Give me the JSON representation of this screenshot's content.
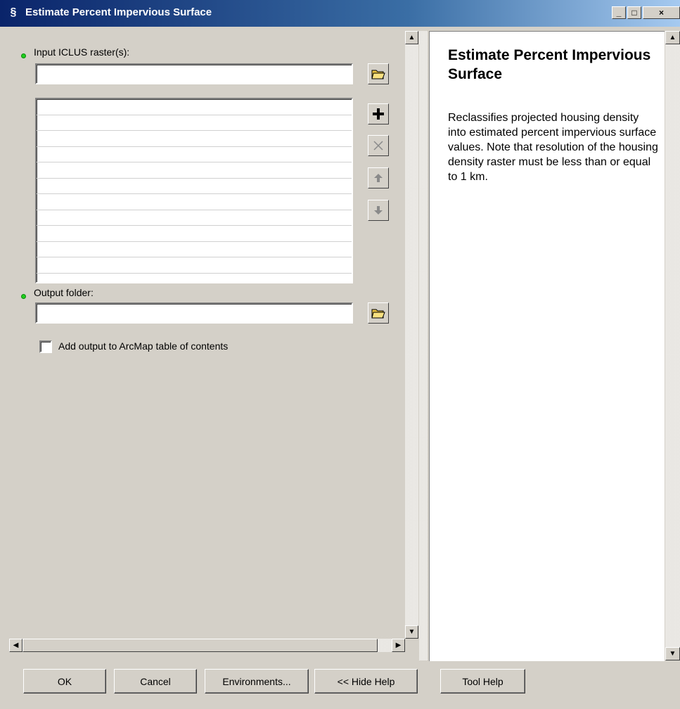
{
  "window": {
    "title": "Estimate Percent Impervious Surface",
    "minimize": "_",
    "maximize": "□",
    "close": "×"
  },
  "form": {
    "input_label": "Input ICLUS raster(s):",
    "input_value": "",
    "list_rows": [
      "",
      "",
      "",
      "",
      "",
      "",
      "",
      "",
      "",
      "",
      ""
    ],
    "output_label": "Output folder:",
    "output_value": "",
    "checkbox_label": "Add output to ArcMap table of contents",
    "checkbox_checked": false
  },
  "help": {
    "title": "Estimate Percent Impervious Surface",
    "body": "Reclassifies projected housing density into estimated percent impervious surface values. Note that resolution of the housing density raster must be less than or equal to 1 km."
  },
  "buttons": {
    "ok": "OK",
    "cancel": "Cancel",
    "environments": "Environments...",
    "hide_help": "<< Hide Help",
    "tool_help": "Tool Help"
  },
  "colors": {
    "required_dot": "#1fcf1f",
    "titlebar_start": "#0a246a"
  }
}
